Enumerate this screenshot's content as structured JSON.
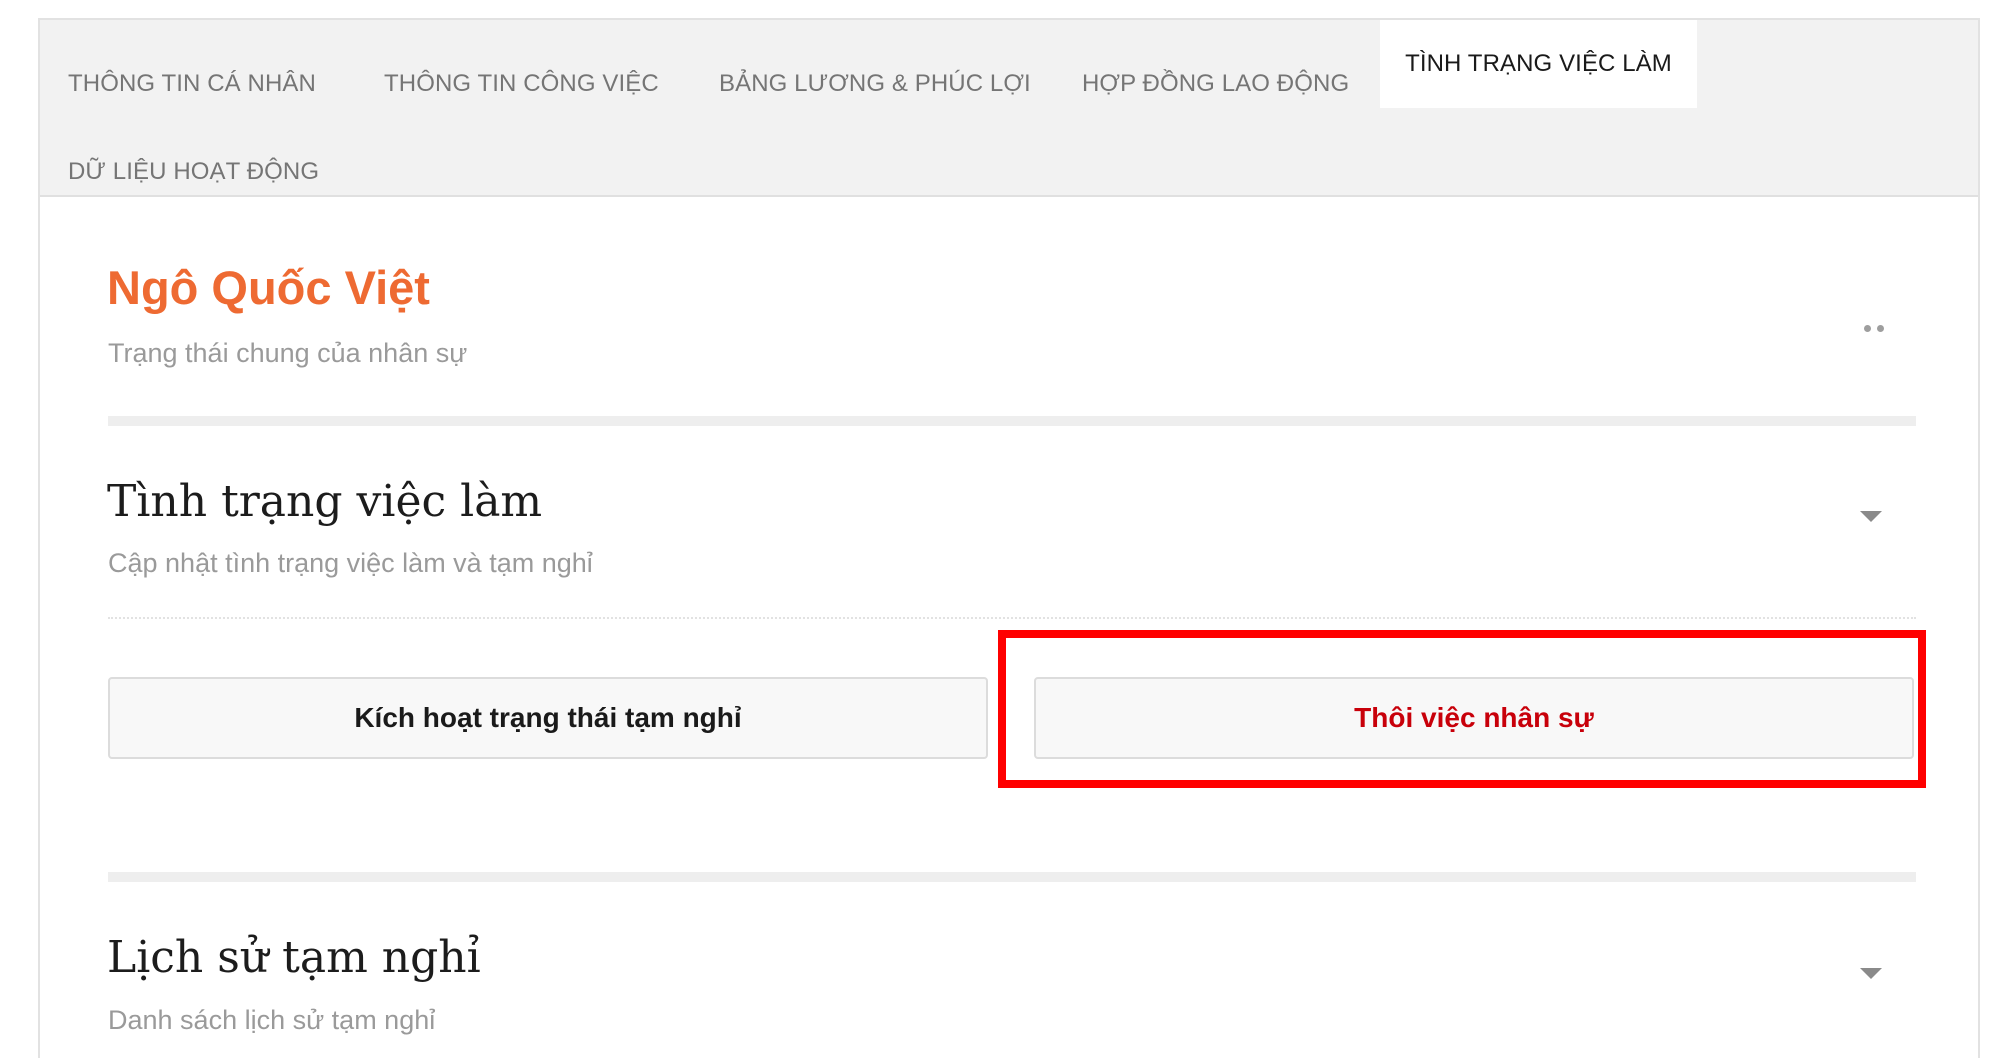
{
  "tabs": [
    {
      "label": "THÔNG TIN CÁ NHÂN",
      "active": false
    },
    {
      "label": "THÔNG TIN CÔNG VIỆC",
      "active": false
    },
    {
      "label": "BẢNG LƯƠNG & PHÚC LỢI",
      "active": false
    },
    {
      "label": "HỢP ĐỒNG LAO ĐỘNG",
      "active": false
    },
    {
      "label": "TÌNH TRẠNG VIỆC LÀM",
      "active": true
    },
    {
      "label": "DỮ LIỆU HOẠT ĐỘNG",
      "active": false
    }
  ],
  "header": {
    "name": "Ngô Quốc Việt",
    "subtitle": "Trạng thái chung của nhân sự",
    "more_icon": "more-horizontal-icon"
  },
  "employment_section": {
    "title": "Tình trạng việc làm",
    "subtitle": "Cập nhật tình trạng việc làm và tạm nghỉ",
    "toggle_icon": "chevron-down-icon",
    "activate_leave_label": "Kích hoạt trạng thái tạm nghỉ",
    "terminate_label": "Thôi việc nhân sự"
  },
  "leave_history_section": {
    "title": "Lịch sử tạm nghỉ",
    "subtitle": "Danh sách lịch sử tạm nghỉ",
    "toggle_icon": "chevron-down-icon"
  },
  "colors": {
    "accent": "#ee6a32",
    "danger_text": "#c8000a",
    "highlight": "#ff0000",
    "tab_bar_bg": "#f2f2f2"
  }
}
